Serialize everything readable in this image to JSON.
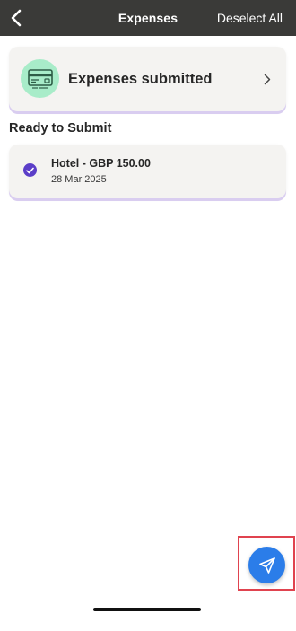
{
  "header": {
    "title": "Expenses",
    "back_icon": "chevron-left-icon",
    "deselect_label": "Deselect All"
  },
  "submitted_card": {
    "label": "Expenses submitted",
    "icon": "credit-card-icon",
    "chevron": "chevron-right-icon",
    "icon_bg_color": "#a8ecc9"
  },
  "section": {
    "title": "Ready to Submit"
  },
  "expenses": [
    {
      "title": "Hotel - GBP 150.00",
      "date": "28 Mar 2025",
      "selected": true
    }
  ],
  "fab": {
    "icon": "send-icon",
    "color": "#2b7de9"
  },
  "colors": {
    "header_bg": "#3a3a38",
    "card_bg": "#f4f3f1",
    "card_accent": "#d9cdf0",
    "check_purple": "#5b3ec8",
    "highlight_red": "#e0434f"
  }
}
